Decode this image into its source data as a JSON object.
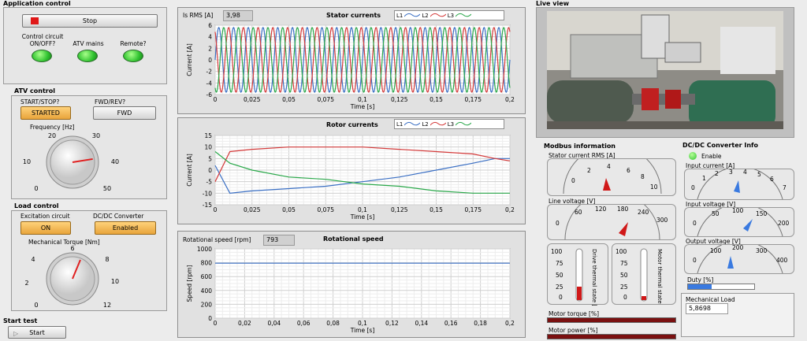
{
  "app": {
    "section_title": "Application control",
    "stop_label": "Stop"
  },
  "control": {
    "control_circuit": "Control circuit\nON/OFF?",
    "atv_mains": "ATV mains",
    "remote": "Remote?"
  },
  "atv": {
    "title": "ATV control",
    "start_stop": "START/STOP?",
    "fwd_rev": "FWD/REV?",
    "started": "STARTED",
    "fwd": "FWD",
    "frequency_label": "Frequency [Hz]",
    "freq_ticks": [
      "0",
      "10",
      "20",
      "30",
      "40",
      "50"
    ],
    "frequency_value": 40
  },
  "load": {
    "title": "Load control",
    "excitation": "Excitation circuit",
    "dcdc": "DC/DC Converter",
    "on": "ON",
    "enabled": "Enabled",
    "torque_label": "Mechanical Torque [Nm]",
    "torque_ticks": [
      "0",
      "2",
      "4",
      "6",
      "8",
      "10",
      "12"
    ],
    "torque_value": 7
  },
  "start": {
    "title": "Start test",
    "label": "Start"
  },
  "stator": {
    "title": "Stator currents",
    "is_rms_label": "Is RMS [A]",
    "is_rms_value": "3,98",
    "legend": [
      "L1",
      "L2",
      "L3"
    ],
    "ylabel": "Current [A]",
    "xlabel": "Time [s]",
    "yticks": [
      "6",
      "4",
      "2",
      "0",
      "-2",
      "-4",
      "-6"
    ],
    "xticks": [
      "0",
      "0,025",
      "0,05",
      "0,075",
      "0,1",
      "0,125",
      "0,15",
      "0,175",
      "0,2"
    ]
  },
  "rotor": {
    "title": "Rotor currents",
    "legend": [
      "L1",
      "L2",
      "L3"
    ],
    "ylabel": "Current [A]",
    "xlabel": "Time [s]",
    "yticks": [
      "15",
      "10",
      "5",
      "0",
      "-5",
      "-10",
      "-15"
    ],
    "xticks": [
      "0",
      "0,025",
      "0,05",
      "0,075",
      "0,1",
      "0,125",
      "0,15",
      "0,175",
      "0,2"
    ]
  },
  "speed": {
    "title": "Rotational speed",
    "label": "Rotational speed [rpm]",
    "value": "793",
    "ylabel": "Speed [rpm]",
    "xlabel": "Time [s]",
    "yticks": [
      "1000",
      "800",
      "600",
      "400",
      "200",
      "0"
    ],
    "xticks": [
      "0",
      "0,02",
      "0,04",
      "0,06",
      "0,08",
      "0,1",
      "0,12",
      "0,14",
      "0,16",
      "0,18",
      "0,2"
    ]
  },
  "live": {
    "title": "Live view"
  },
  "modbus": {
    "title": "Modbus information",
    "stator_rms": "Stator current RMS [A]",
    "stator_ticks": [
      "0",
      "2",
      "4",
      "6",
      "8",
      "10"
    ],
    "line_voltage": "Line voltage [V]",
    "line_ticks": [
      "0",
      "60",
      "120",
      "180",
      "240",
      "300"
    ],
    "drive_thermal": "Drive thermal state [%]",
    "motor_thermal": "Motor thermal state [%]",
    "thermo_ticks": [
      "100",
      "75",
      "50",
      "25",
      "0"
    ],
    "motor_torque": "Motor torque [%]",
    "motor_power": "Motor power [%]"
  },
  "dcdc": {
    "title": "DC/DC Converter Info",
    "enable": "Enable",
    "input_current": "Input current [A]",
    "ic_ticks": [
      "0",
      "1",
      "2",
      "3",
      "4",
      "5",
      "6",
      "7"
    ],
    "input_voltage": "Input voltage [V]",
    "iv_ticks": [
      "0",
      "50",
      "100",
      "150",
      "200"
    ],
    "output_voltage": "Output voltage [V]",
    "ov_ticks": [
      "0",
      "100",
      "200",
      "300",
      "400"
    ],
    "duty": "Duty [%]",
    "mech_load": "Mechanical Load",
    "mech_value": "5,8698"
  },
  "chart_data": [
    {
      "type": "line",
      "title": "Stator currents",
      "xlabel": "Time [s]",
      "ylabel": "Current [A]",
      "xlim": [
        0,
        0.2
      ],
      "ylim": [
        -6,
        6
      ],
      "series": [
        {
          "name": "L1",
          "amplitude": 5.6,
          "frequency_hz": 100,
          "phase_deg": 0
        },
        {
          "name": "L2",
          "amplitude": 5.6,
          "frequency_hz": 100,
          "phase_deg": 120
        },
        {
          "name": "L3",
          "amplitude": 5.6,
          "frequency_hz": 100,
          "phase_deg": 240
        }
      ],
      "colors": [
        "#3a6fc4",
        "#d43a3a",
        "#2aa84a"
      ]
    },
    {
      "type": "line",
      "title": "Rotor currents",
      "xlabel": "Time [s]",
      "ylabel": "Current [A]",
      "xlim": [
        0,
        0.2
      ],
      "ylim": [
        -15,
        15
      ],
      "x": [
        0,
        0.01,
        0.025,
        0.05,
        0.075,
        0.1,
        0.125,
        0.15,
        0.175,
        0.19,
        0.2
      ],
      "series": [
        {
          "name": "L1",
          "values": [
            2,
            -10,
            -9,
            -8,
            -7,
            -5,
            -3,
            0,
            3,
            5,
            5
          ]
        },
        {
          "name": "L2",
          "values": [
            -5,
            8,
            9,
            10,
            10,
            10,
            9,
            8,
            7,
            5,
            4
          ]
        },
        {
          "name": "L3",
          "values": [
            8,
            3,
            0,
            -3,
            -4,
            -6,
            -7,
            -9,
            -10,
            -10,
            -10
          ]
        }
      ],
      "colors": [
        "#3a6fc4",
        "#d43a3a",
        "#2aa84a"
      ]
    },
    {
      "type": "line",
      "title": "Rotational speed",
      "xlabel": "Time [s]",
      "ylabel": "Speed [rpm]",
      "xlim": [
        0,
        0.2
      ],
      "ylim": [
        0,
        1000
      ],
      "x": [
        0,
        0.2
      ],
      "series": [
        {
          "name": "",
          "values": [
            793,
            793
          ]
        }
      ],
      "colors": [
        "#3a6fc4"
      ]
    }
  ]
}
